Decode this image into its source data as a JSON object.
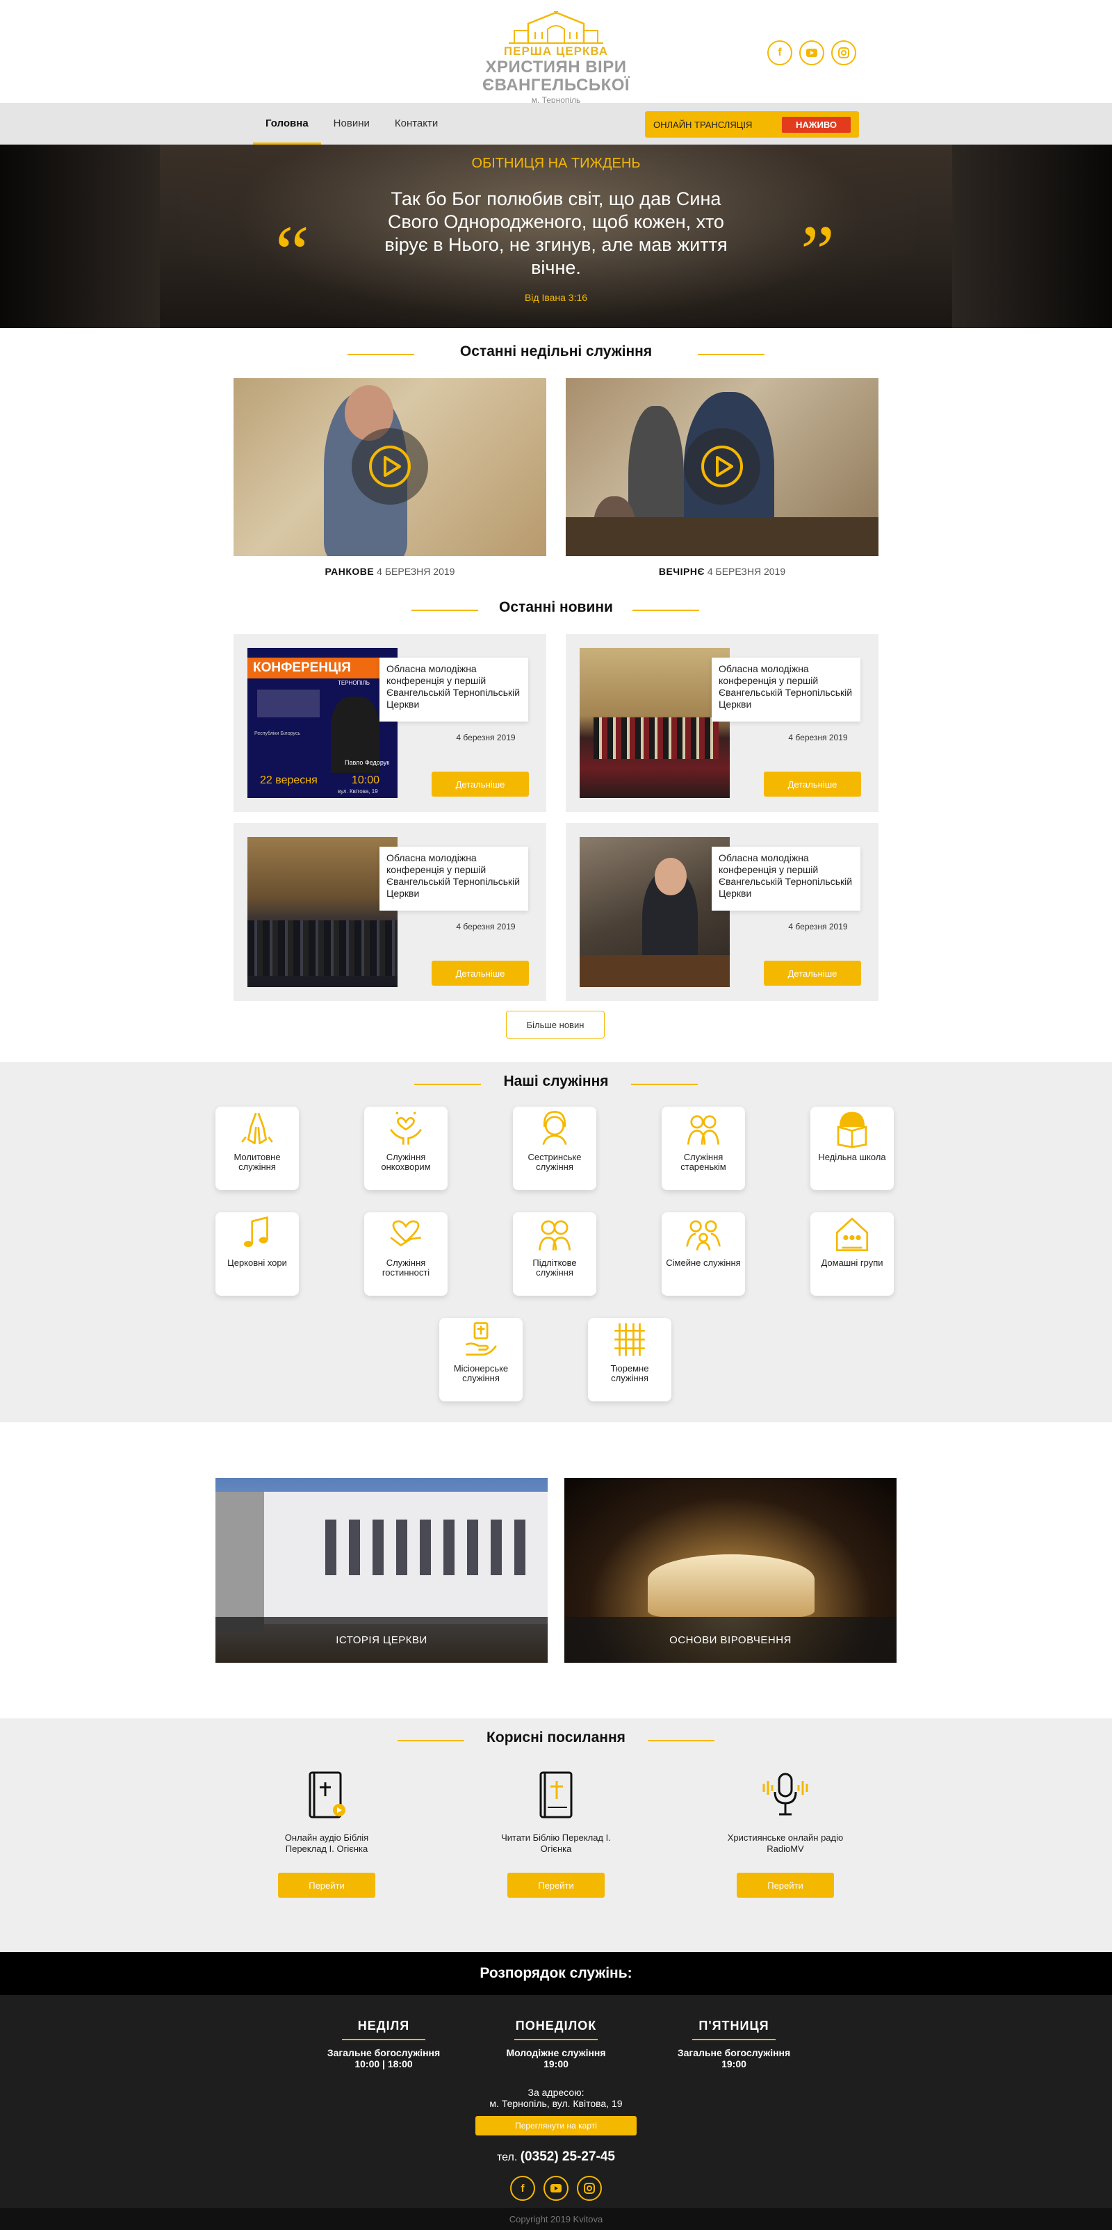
{
  "header": {
    "logo_line1": "ПЕРША ЦЕРКВА",
    "logo_line2": "ХРИСТИЯН ВІРИ ЄВАНГЕЛЬСЬКОЇ",
    "logo_line3": "м. Тернопіль",
    "social": [
      "facebook-icon",
      "youtube-icon",
      "instagram-icon"
    ]
  },
  "nav": {
    "items": [
      "Головна",
      "Новини",
      "Контакти"
    ],
    "live_label": "ОНЛАЙН ТРАНСЛЯЦІЯ",
    "live_badge": "НАЖИВО"
  },
  "hero": {
    "title": "ОБІТНИЦЯ НА ТИЖДЕНЬ",
    "quote": "Так бо Бог полюбив світ, що дав Сина Свого Однородженого, щоб кожен, хто вірує в Нього, не згинув, але мав життя вічне.",
    "reference": "Від Івана 3:16"
  },
  "services": {
    "title": "Останні недільні служіння",
    "items": [
      {
        "type": "РАНКОВЕ",
        "date": "4 БЕРЕЗНЯ 2019"
      },
      {
        "type": "ВЕЧІРНЄ",
        "date": "4 БЕРЕЗНЯ 2019"
      }
    ]
  },
  "news": {
    "title": "Останні новини",
    "items": [
      {
        "text": "Обласна молодіжна конференція у першій Євангельській Тернопільській Церкви",
        "date": "4 березня 2019",
        "button": "Детальніше",
        "poster_title": "КОНФЕРЕНЦІЯ",
        "poster_city": "ТЕРНОПІЛЬ",
        "poster_name": "Павло Федорук",
        "poster_date": "22 вересня",
        "poster_time": "10:00",
        "poster_addr": "вул. Квітова, 19",
        "poster_country": "Республіки Білорусь"
      },
      {
        "text": "Обласна молодіжна конференція у першій Євангельській Тернопільській Церкви",
        "date": "4 березня 2019",
        "button": "Детальніше"
      },
      {
        "text": "Обласна молодіжна конференція у першій Євангельській Тернопільській Церкви",
        "date": "4 березня 2019",
        "button": "Детальніше"
      },
      {
        "text": "Обласна молодіжна конференція у першій Євангельській Тернопільській Церкви",
        "date": "4 березня 2019",
        "button": "Детальніше"
      }
    ],
    "more_button": "Більше новин"
  },
  "ministries": {
    "title": "Наші служіння",
    "items": [
      {
        "label": "Молитовне служіння",
        "icon": "praying-hands-icon"
      },
      {
        "label": "Служіння онкохворим",
        "icon": "hands-heart-icon"
      },
      {
        "label": "Сестринське служіння",
        "icon": "woman-icon"
      },
      {
        "label": "Служіння старенькім",
        "icon": "elderly-couple-icon"
      },
      {
        "label": "Недільна школа",
        "icon": "school-book-icon"
      },
      {
        "label": "Церковні хори",
        "icon": "music-note-icon"
      },
      {
        "label": "Служіння гостинності",
        "icon": "handshake-heart-icon"
      },
      {
        "label": "Підліткове служіння",
        "icon": "teens-icon"
      },
      {
        "label": "Сімейне служіння",
        "icon": "family-icon"
      },
      {
        "label": "Домашні групи",
        "icon": "house-group-icon"
      },
      {
        "label": "Місіонерське служіння",
        "icon": "mission-hand-icon"
      },
      {
        "label": "Тюремне служіння",
        "icon": "prison-bars-icon"
      }
    ]
  },
  "about": {
    "history": "ІСТОРІЯ ЦЕРКВИ",
    "beliefs": "ОСНОВИ ВІРОВЧЕННЯ"
  },
  "links": {
    "title": "Корисні посилання",
    "items": [
      {
        "text": "Онлайн аудіо Біблія Переклад І. Огієнка",
        "button": "Перейти",
        "icon": "audio-bible-icon"
      },
      {
        "text": "Читати Біблію Переклад І. Огієнка",
        "button": "Перейти",
        "icon": "bible-icon"
      },
      {
        "text": "Християнське онлайн радіо RadioMV",
        "button": "Перейти",
        "icon": "microphone-icon"
      }
    ]
  },
  "schedule": {
    "title": "Розпорядок служінь:",
    "days": [
      {
        "day": "НЕДІЛЯ",
        "service": "Загальне богослужіння",
        "time": "10:00 | 18:00"
      },
      {
        "day": "ПОНЕДІЛОК",
        "service": "Молодіжне служіння",
        "time": "19:00"
      },
      {
        "day": "П'ЯТНИЦЯ",
        "service": "Загальне богослужіння",
        "time": "19:00"
      }
    ],
    "address_label": "За адресою:",
    "address": "м. Тернопіль, вул. Квітова, 19",
    "map_button": "Переглянути на карті",
    "tel_prefix": "тел.",
    "tel": "(0352) 25-27-45"
  },
  "footer": {
    "copyright": "Copyright 2019 Kvitova"
  },
  "colors": {
    "accent": "#f5b800",
    "live": "#e23b1e",
    "dark": "#1e1e1e"
  }
}
